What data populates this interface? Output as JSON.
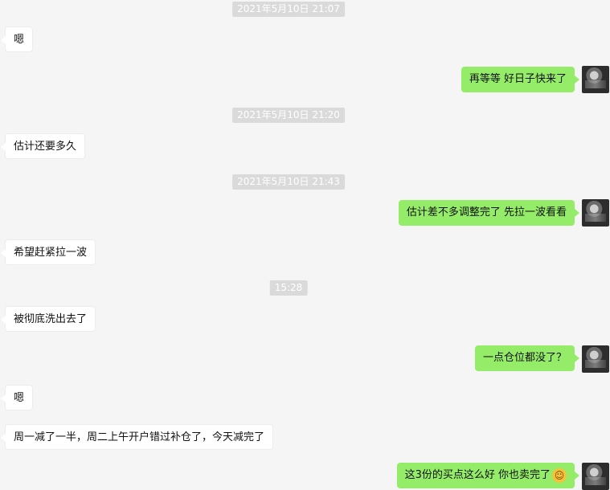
{
  "messages": [
    {
      "type": "time",
      "text": "2021年5月10日 21:07"
    },
    {
      "type": "left",
      "text": "嗯"
    },
    {
      "type": "right",
      "text": "再等等 好日子快来了"
    },
    {
      "type": "time",
      "text": "2021年5月10日 21:20"
    },
    {
      "type": "left",
      "text": "估计还要多久"
    },
    {
      "type": "time",
      "text": "2021年5月10日 21:43"
    },
    {
      "type": "right",
      "text": "估计差不多调整完了 先拉一波看看"
    },
    {
      "type": "left",
      "text": "希望赶紧拉一波"
    },
    {
      "type": "time",
      "text": "15:28"
    },
    {
      "type": "left",
      "text": "被彻底洗出去了"
    },
    {
      "type": "right",
      "text": "一点仓位都没了？"
    },
    {
      "type": "left",
      "text": "嗯"
    },
    {
      "type": "left",
      "text": "周一减了一半，周二上午开户错过补仓了，今天减完了"
    },
    {
      "type": "right",
      "text": "这3份的买点这么好 你也卖完了",
      "emoji": "laughing-face-icon"
    }
  ]
}
